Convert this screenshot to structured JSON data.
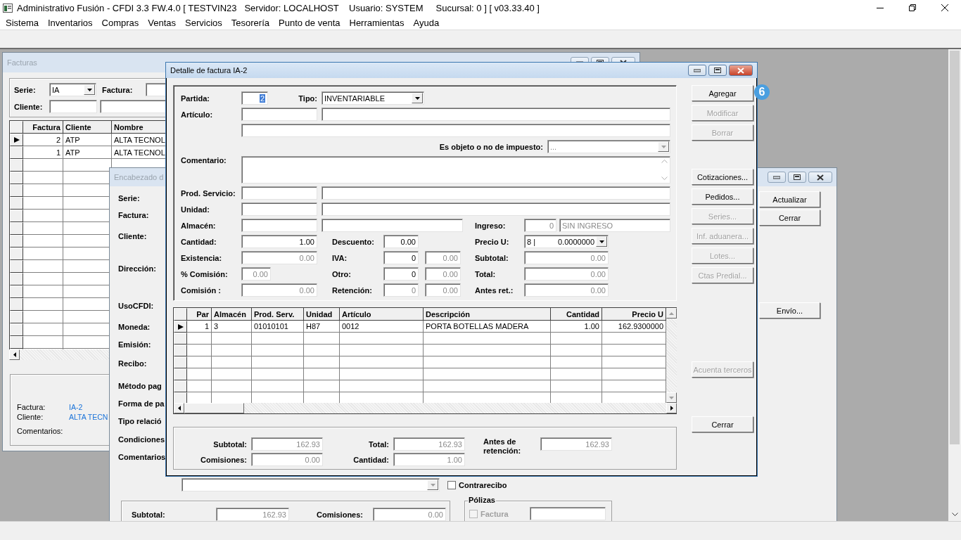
{
  "app": {
    "title": "Administrativo Fusión - CFDI 3.3 FW.4.0 [ TESTVIN23   Servidor: LOCALHOST    Usuario: SYSTEM     Sucursal: 0 ] [ v03.33.40 ]"
  },
  "menu": [
    "Sistema",
    "Inventarios",
    "Compras",
    "Ventas",
    "Servicios",
    "Tesorería",
    "Punto de venta",
    "Herramientas",
    "Ayuda"
  ],
  "facturas_window": {
    "title": "Facturas",
    "active": false,
    "filters": {
      "serie_label": "Serie:",
      "serie_value": "IA",
      "factura_label": "Factura:",
      "cliente_label": "Cliente:"
    },
    "table": {
      "columns": [
        "Factura",
        "Cliente",
        "Nombre"
      ],
      "rows": [
        {
          "cells": [
            "2",
            "ATP",
            "ALTA TECNOL"
          ],
          "current": true
        },
        {
          "cells": [
            "1",
            "ATP",
            "ALTA TECNOL"
          ],
          "current": false
        }
      ]
    },
    "summary": [
      {
        "label": "Factura:",
        "value": "IA-2"
      },
      {
        "label": "Cliente:",
        "value": "ALTA TECN"
      },
      {
        "label": "Comentarios:"
      }
    ]
  },
  "header_window": {
    "title": "Encabezado d",
    "active": false,
    "labels": [
      "Serie:",
      "Factura:",
      "Cliente:",
      "Dirección:",
      "UsoCFDI:",
      "Moneda:",
      "Emisión:",
      "Recibo:",
      "Método pag",
      "Forma de pa",
      "Tipo relació",
      "Condiciones",
      "Comentarios"
    ],
    "buttons": [
      "Actualizar",
      "Cerrar",
      "Envío..."
    ],
    "contrarecibo": {
      "label": "Contrarecibo",
      "checked": false
    },
    "totals": [
      {
        "label": "Subtotal:",
        "value": "162.93"
      },
      {
        "label": "Comisiones:",
        "value": "0.00"
      }
    ],
    "polizas": {
      "title": "Pólizas",
      "factura": {
        "label": "Factura",
        "checked": false,
        "disabled": true
      }
    }
  },
  "detail_window": {
    "title": "Detalle de factura IA-2",
    "active": true,
    "form": {
      "partida": {
        "label": "Partida:",
        "value": "2"
      },
      "tipo": {
        "label": "Tipo:",
        "value": "INVENTARIABLE"
      },
      "articulo": {
        "label": "Artículo:"
      },
      "objeto_impuesto": {
        "label": "Es objeto o no de impuesto:",
        "value": "...",
        "disabled": true
      },
      "comentario": {
        "label": "Comentario:"
      },
      "prod_servicio": {
        "label": "Prod. Servicio:"
      },
      "unidad": {
        "label": "Unidad:"
      },
      "almacen": {
        "label": "Almacén:"
      },
      "ingreso": {
        "label": "Ingreso:",
        "code": "0",
        "name": "SIN INGRESO",
        "disabled": true
      },
      "cantidad": {
        "label": "Cantidad:",
        "value": "1.00",
        "disabled": false
      },
      "descuento": {
        "label": "Descuento:",
        "value": "0.00",
        "disabled": false
      },
      "precio_u": {
        "label": "Precio U:",
        "prefix": "8 |",
        "value": "0.0000000"
      },
      "existencia": {
        "label": "Existencia:",
        "value": "0.00",
        "disabled": true
      },
      "iva": {
        "label": "IVA:",
        "rate": "0",
        "rate_disabled": false,
        "amount": "0.00",
        "amount_disabled": true
      },
      "subtotal": {
        "label": "Subtotal:",
        "value": "0.00",
        "disabled": true
      },
      "comision_pct": {
        "label": "% Comisión:",
        "value": "0.00",
        "disabled": true
      },
      "otro": {
        "label": "Otro:",
        "rate": "0",
        "rate_disabled": false,
        "amount": "0.00",
        "amount_disabled": true
      },
      "total": {
        "label": "Total:",
        "value": "0.00",
        "disabled": true
      },
      "comision": {
        "label": "Comisión :",
        "value": "0.00",
        "disabled": true
      },
      "retencion": {
        "label": "Retención:",
        "rate": "0",
        "rate_disabled": true,
        "amount": "0.00",
        "amount_disabled": true
      },
      "antes_ret": {
        "label": "Antes ret.:",
        "value": "0.00",
        "disabled": true
      }
    },
    "table": {
      "columns": [
        "Par",
        "Almacén",
        "Prod. Serv.",
        "Unidad",
        "Artículo",
        "Descripción",
        "Cantidad",
        "Precio U"
      ],
      "rows": [
        {
          "cells": [
            "1",
            "3",
            "01010101",
            "H87",
            "0012",
            "PORTA BOTELLAS MADERA",
            "1.00",
            "162.9300000"
          ],
          "current": true
        }
      ]
    },
    "totals": [
      {
        "label": "Subtotal:",
        "value": "162.93"
      },
      {
        "label": "Comisiones:",
        "value": "0.00"
      },
      {
        "label": "Total:",
        "value": "162.93"
      },
      {
        "label": "Cantidad:",
        "value": "1.00"
      },
      {
        "label": "Antes de retención:",
        "value": "162.93"
      }
    ],
    "button_groups": [
      [
        {
          "label": "Agregar",
          "disabled": false
        },
        {
          "label": "Modificar",
          "disabled": true
        },
        {
          "label": "Borrar",
          "disabled": true
        }
      ],
      [
        {
          "label": "Cotizaciones...",
          "disabled": false
        },
        {
          "label": "Pedidos...",
          "disabled": false
        },
        {
          "label": "Series...",
          "disabled": true
        },
        {
          "label": "Inf. aduanera...",
          "disabled": true
        },
        {
          "label": "Lotes...",
          "disabled": true
        },
        {
          "label": "Ctas Predial...",
          "disabled": true
        }
      ],
      [
        {
          "label": "Acuenta terceros",
          "disabled": true
        }
      ],
      [
        {
          "label": "Cerrar",
          "disabled": false
        }
      ]
    ]
  },
  "badge": {
    "text": "6"
  }
}
